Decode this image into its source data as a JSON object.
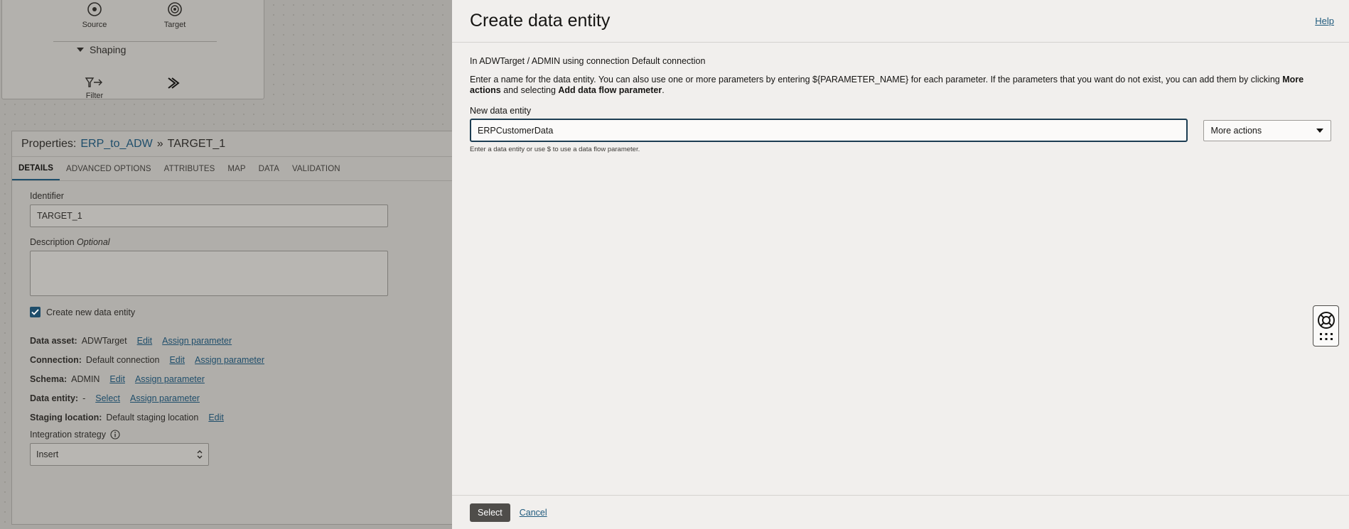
{
  "background": {
    "palette": {
      "source_label": "Source",
      "target_label": "Target",
      "section_label": "Shaping",
      "filter_label": "Filter"
    },
    "properties": {
      "prefix": "Properties:",
      "flow_link": "ERP_to_ADW",
      "separator": "»",
      "node": "TARGET_1",
      "tabs": [
        "DETAILS",
        "ADVANCED OPTIONS",
        "ATTRIBUTES",
        "MAP",
        "DATA",
        "VALIDATION"
      ],
      "identifier_label": "Identifier",
      "identifier_value": "TARGET_1",
      "description_label": "Description",
      "description_optional": "Optional",
      "create_checkbox_label": "Create new data entity",
      "data_asset_label": "Data asset:",
      "data_asset_value": "ADWTarget",
      "connection_label": "Connection:",
      "connection_value": "Default connection",
      "schema_label": "Schema:",
      "schema_value": "ADMIN",
      "data_entity_label": "Data entity:",
      "data_entity_value": "-",
      "staging_label": "Staging location:",
      "staging_value": "Default staging location",
      "edit_link": "Edit",
      "assign_link": "Assign parameter",
      "select_link": "Select",
      "integration_label": "Integration strategy",
      "integration_value": "Insert"
    }
  },
  "drawer": {
    "title": "Create data entity",
    "help": "Help",
    "context": "In ADWTarget / ADMIN using connection Default connection",
    "instr_part1": "Enter a name for the data entity. You can also use one or more parameters by entering ${PARAMETER_NAME} for each parameter. If the parameters that you want do not exist, you can add them by clicking ",
    "instr_bold1": "More actions",
    "instr_part2": " and selecting ",
    "instr_bold2": "Add data flow parameter",
    "instr_part3": ".",
    "new_entity_label": "New data entity",
    "new_entity_value": "ERPCustomerData",
    "more_actions": "More actions",
    "hint": "Enter a data entity or use $ to use a data flow parameter.",
    "select_button": "Select",
    "cancel_link": "Cancel"
  },
  "colors": {
    "accent": "#1f4e6b",
    "link": "#1f5a7d",
    "primary_button": "#4f4d4a",
    "drawer_bg": "#f1efed"
  }
}
